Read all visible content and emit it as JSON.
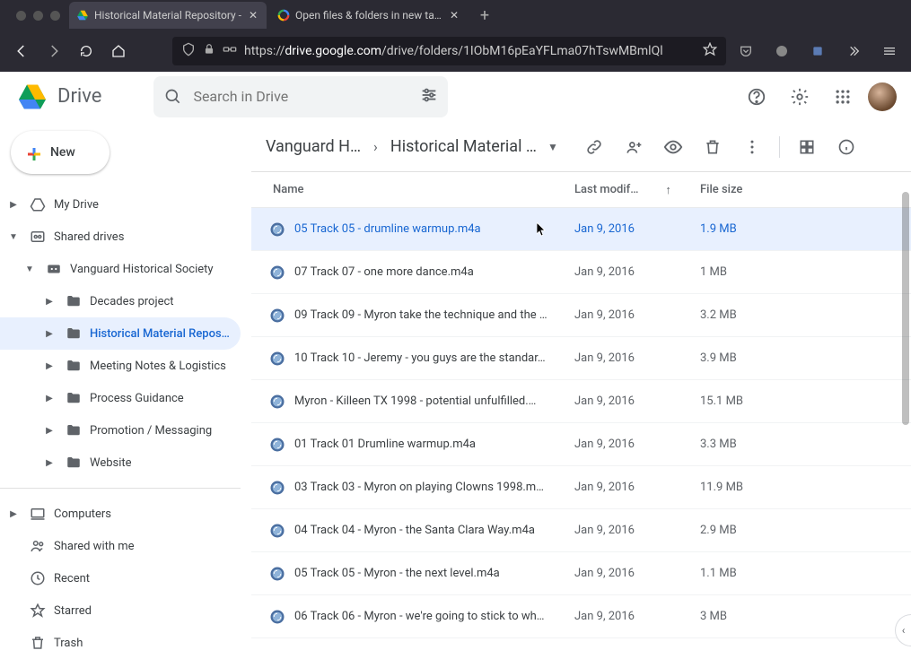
{
  "browser": {
    "tabs": [
      {
        "title": "Historical Material Repository -",
        "favicon_colors": [
          "#0f9d58",
          "#ffba00",
          "#4285f4"
        ],
        "active": true
      },
      {
        "title": "Open files & folders in new tab?",
        "favicon_multi": true,
        "active": false
      }
    ],
    "url_prefix": "https://",
    "url_host": "drive.google.com",
    "url_path": "/drive/folders/1IObM16pEaYFLma07hTswMBmlQl"
  },
  "app": {
    "title": "Drive",
    "search_placeholder": "Search in Drive",
    "new_button": "New"
  },
  "sidebar": {
    "my_drive": "My Drive",
    "shared_drives": "Shared drives",
    "drive_name": "Vanguard Historical Society",
    "folders": [
      "Decades project",
      "Historical Material Repos…",
      "Meeting Notes & Logistics",
      "Process Guidance",
      "Promotion / Messaging",
      "Website"
    ],
    "computers": "Computers",
    "shared_with_me": "Shared with me",
    "recent": "Recent",
    "starred": "Starred",
    "trash": "Trash"
  },
  "breadcrumb": {
    "parent": "Vanguard H…",
    "current": "Historical Material …"
  },
  "columns": {
    "name": "Name",
    "last_modified": "Last modif…",
    "file_size": "File size"
  },
  "files": [
    {
      "name": "05 Track 05 - drumline warmup.m4a",
      "modified": "Jan 9, 2016",
      "size": "1.9 MB",
      "selected": true
    },
    {
      "name": "07 Track 07 - one more dance.m4a",
      "modified": "Jan 9, 2016",
      "size": "1 MB"
    },
    {
      "name": "09 Track 09 - Myron take the technique and the …",
      "modified": "Jan 9, 2016",
      "size": "3.2 MB"
    },
    {
      "name": "10 Track 10 - Jeremy - you guys are the standar…",
      "modified": "Jan 9, 2016",
      "size": "3.9 MB"
    },
    {
      "name": "Myron - Killeen TX 1998 - potential unfulfilled.…",
      "modified": "Jan 9, 2016",
      "size": "15.1 MB"
    },
    {
      "name": "01 Track 01 Drumline warmup.m4a",
      "modified": "Jan 9, 2016",
      "size": "3.3 MB"
    },
    {
      "name": "03 Track 03 - Myron on playing Clowns 1998.m…",
      "modified": "Jan 9, 2016",
      "size": "11.9 MB"
    },
    {
      "name": "04 Track 04 - Myron - the Santa Clara Way.m4a",
      "modified": "Jan 9, 2016",
      "size": "2.9 MB"
    },
    {
      "name": "05 Track 05 - Myron - the next level.m4a",
      "modified": "Jan 9, 2016",
      "size": "1.1 MB"
    },
    {
      "name": "06 Track 06 - Myron - we're going to stick to wh…",
      "modified": "Jan 9, 2016",
      "size": "3 MB"
    }
  ]
}
